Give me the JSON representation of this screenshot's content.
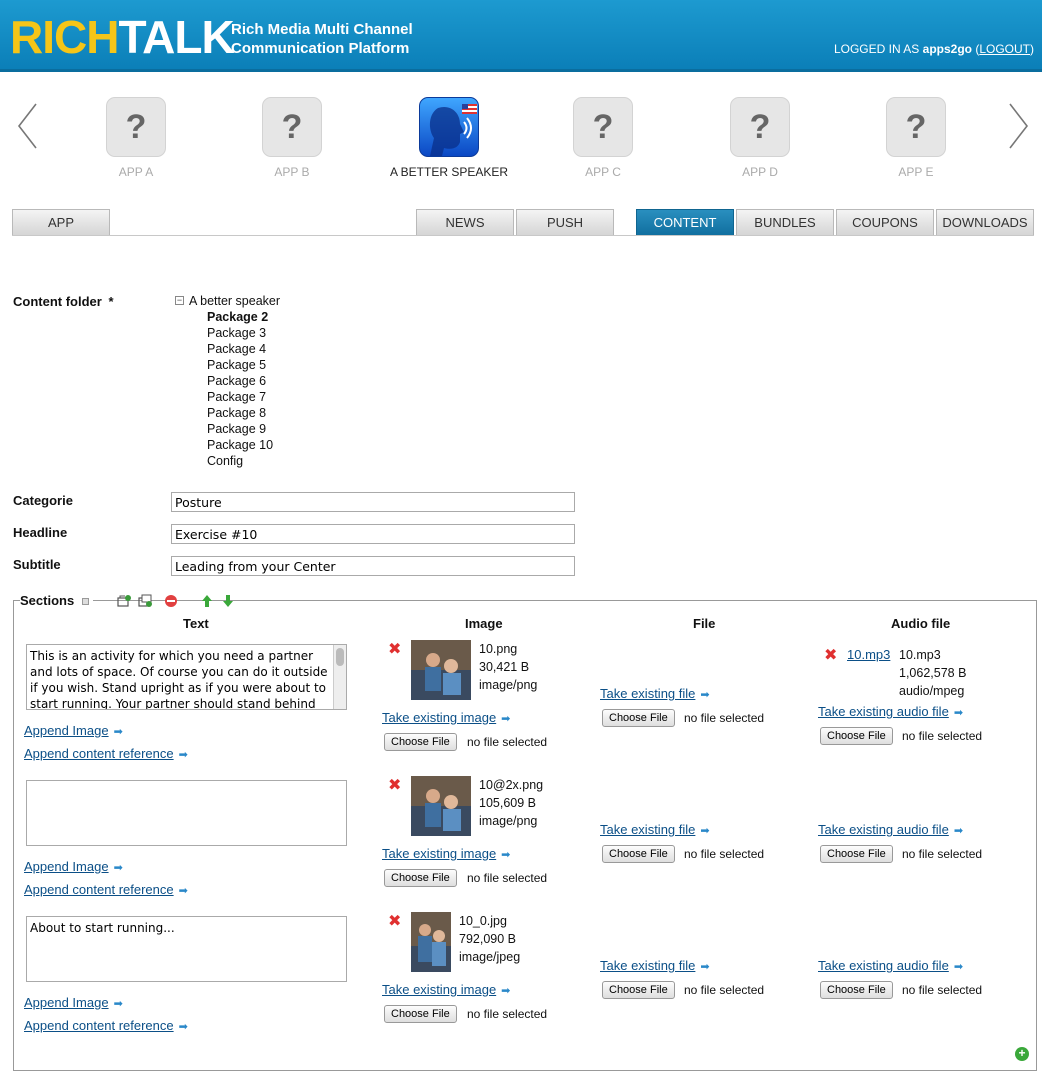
{
  "header": {
    "logo_rich": "RICH",
    "logo_talk": "TALK",
    "tagline_1": "Rich Media Multi Channel",
    "tagline_2": "Communication Platform",
    "login_prefix": "LOGGED IN AS",
    "user": "apps2go",
    "logout": "LOGOUT"
  },
  "apps": [
    {
      "label": "APP A",
      "icon": "?"
    },
    {
      "label": "APP B",
      "icon": "?"
    },
    {
      "label": "A BETTER SPEAKER",
      "icon": "speaker-app-icon"
    },
    {
      "label": "APP C",
      "icon": "?"
    },
    {
      "label": "APP D",
      "icon": "?"
    },
    {
      "label": "APP E",
      "icon": "?"
    }
  ],
  "tabs": {
    "app": "APP",
    "news": "NEWS",
    "push": "PUSH",
    "content": "CONTENT",
    "bundles": "BUNDLES",
    "coupons": "COUPONS",
    "downloads": "DOWNLOADS"
  },
  "form": {
    "content_folder_label": "Content folder",
    "required_mark": "*",
    "tree_root": "A better speaker",
    "tree_items": [
      "Package 2",
      "Package 3",
      "Package 4",
      "Package 5",
      "Package 6",
      "Package 7",
      "Package 8",
      "Package 9",
      "Package 10",
      "Config"
    ],
    "categorie_label": "Categorie",
    "categorie_value": "Posture",
    "headline_label": "Headline",
    "headline_value": "Exercise #10",
    "subtitle_label": "Subtitle",
    "subtitle_value": "Leading from your Center"
  },
  "sections": {
    "title": "Sections",
    "col_text": "Text",
    "col_image": "Image",
    "col_file": "File",
    "col_audio": "Audio file",
    "append_image": "Append Image",
    "append_ref": "Append content reference",
    "take_image": "Take existing image",
    "take_file": "Take existing file",
    "take_audio": "Take existing audio file",
    "choose_file": "Choose File",
    "no_file": "no file selected",
    "rows": [
      {
        "text": "This is an activity for which you need a partner and lots of space. Of course you can do it outside if you wish. Stand upright as if you were about to start running. Your partner should stand behind",
        "image_name": "10.png",
        "image_size": "30,421 B",
        "image_type": "image/png",
        "audio_link": "10.mp3",
        "audio_name": "10.mp3",
        "audio_size": "1,062,578 B",
        "audio_type": "audio/mpeg"
      },
      {
        "text": "",
        "image_name": "10@2x.png",
        "image_size": "105,609 B",
        "image_type": "image/png"
      },
      {
        "text": "About to start running...",
        "image_name": "10_0.jpg",
        "image_size": "792,090 B",
        "image_type": "image/jpeg"
      }
    ]
  },
  "colors": {
    "header_blue": "#1d9ad0",
    "logo_yellow": "#f5c518",
    "tab_active": "#1a80b0",
    "link": "#0b4f87"
  }
}
